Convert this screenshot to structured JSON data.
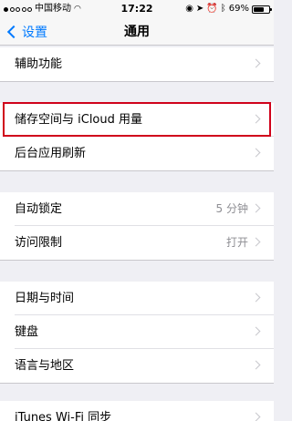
{
  "status_bar": {
    "carrier": "中国移动",
    "time": "17:22",
    "battery_percent": "69%",
    "battery_level": 0.69
  },
  "nav": {
    "back_label": "设置",
    "title": "通用"
  },
  "groups": [
    {
      "items": [
        {
          "label": "辅助功能",
          "value": ""
        }
      ]
    },
    {
      "items": [
        {
          "label": "储存空间与 iCloud 用量",
          "value": "",
          "highlighted": true
        },
        {
          "label": "后台应用刷新",
          "value": ""
        }
      ]
    },
    {
      "items": [
        {
          "label": "自动锁定",
          "value": "5 分钟"
        },
        {
          "label": "访问限制",
          "value": "打开"
        }
      ]
    },
    {
      "items": [
        {
          "label": "日期与时间",
          "value": ""
        },
        {
          "label": "键盘",
          "value": ""
        },
        {
          "label": "语言与地区",
          "value": ""
        }
      ]
    },
    {
      "items": [
        {
          "label": "iTunes Wi-Fi 同步",
          "value": ""
        }
      ]
    }
  ],
  "colors": {
    "accent": "#007aff",
    "highlight": "#d0021b",
    "background": "#efeff4"
  }
}
